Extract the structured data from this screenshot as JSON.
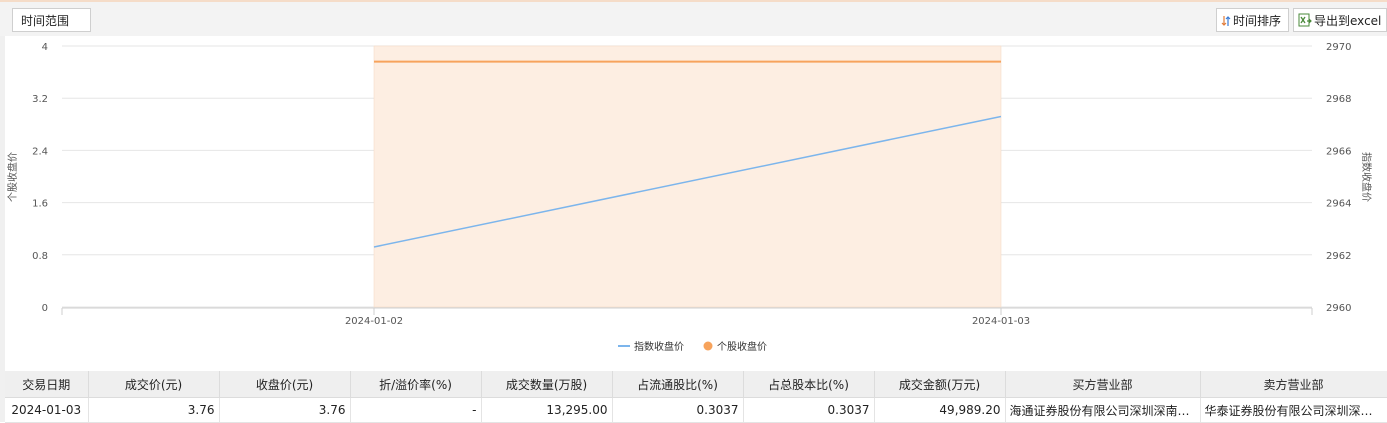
{
  "toolbar": {
    "range_label": "时间范围",
    "sort_label": "时间排序",
    "export_label": "导出到excel"
  },
  "chart_data": {
    "type": "line",
    "categories": [
      "2024-01-02",
      "2024-01-03"
    ],
    "left_axis": {
      "label": "个股收盘价",
      "ylim": [
        0,
        4
      ],
      "ticks": [
        0,
        0.8,
        1.6,
        2.4,
        3.2,
        4
      ]
    },
    "right_axis": {
      "label": "指数收盘价",
      "ylim": [
        2960,
        2970
      ],
      "ticks": [
        2960,
        2962,
        2964,
        2966,
        2968,
        2970
      ]
    },
    "series": [
      {
        "name": "指数收盘价",
        "axis": "right",
        "color": "#7cb5ec",
        "values": [
          2962.3,
          2967.3
        ]
      },
      {
        "name": "个股收盘价",
        "axis": "left",
        "color": "#f7a35c",
        "values": [
          3.76,
          3.76
        ]
      }
    ],
    "grid": true,
    "legend": "bottom-center"
  },
  "table": {
    "headers": [
      "交易日期",
      "成交价(元)",
      "收盘价(元)",
      "折/溢价率(%)",
      "成交数量(万股)",
      "占流通股比(%)",
      "占总股本比(%)",
      "成交金额(万元)",
      "买方营业部",
      "卖方营业部"
    ],
    "rows": [
      [
        "2024-01-03",
        "3.76",
        "3.76",
        "-",
        "13,295.00",
        "0.3037",
        "0.3037",
        "49,989.20",
        "海通证券股份有限公司深圳深南…",
        "华泰证券股份有限公司深圳深南…"
      ]
    ]
  }
}
